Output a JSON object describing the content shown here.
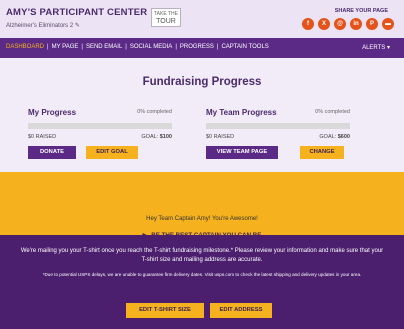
{
  "header": {
    "title": "AMY'S PARTICIPANT CENTER",
    "team": "Alzheimer's Eliminators 2",
    "edit_icon": "pencil-icon",
    "tour_small": "TAKE THE",
    "tour_big": "TOUR",
    "share_label": "SHARE YOUR PAGE",
    "social_icons": [
      "facebook-icon",
      "x-icon",
      "email-icon",
      "linkedin-icon",
      "pinterest-icon",
      "sms-icon"
    ],
    "social_glyphs": [
      "f",
      "X",
      "@",
      "in",
      "P",
      "▬"
    ]
  },
  "nav": {
    "items": [
      "DASHBOARD",
      "MY PAGE",
      "SEND EMAIL",
      "SOCIAL MEDIA",
      "PROGRESS",
      "CAPTAIN TOOLS"
    ],
    "alerts": "ALERTS ▾"
  },
  "fundraising": {
    "title": "Fundraising Progress",
    "my": {
      "title": "My Progress",
      "pct": "0% completed",
      "progress_fraction": 0,
      "raised": "$0 RAISED",
      "goal_label": "GOAL:",
      "goal_value": "$100",
      "btn1": "DONATE",
      "btn2": "EDIT GOAL"
    },
    "team": {
      "title": "My Team Progress",
      "pct": "0% completed",
      "progress_fraction": 0,
      "raised": "$0 RAISED",
      "goal_label": "GOAL:",
      "goal_value": "$600",
      "btn1": "VIEW TEAM PAGE",
      "btn2": "CHANGE"
    }
  },
  "captain": {
    "message": "Hey Team Captain Amy! You're Awesome!",
    "link": "BE THE BEST CAPTAIN YOU CAN BE"
  },
  "tshirt": {
    "text": "We're mailing you your T-shirt once you reach the T-shirt fundraising milestone.* Please review your information and make sure that your T-shirt size and mailing address are accurate.",
    "note": "*Due to potential USPS delays, we are unable to guarantee firm delivery dates. Visit usps.com to check the latest shipping and delivery updates in your area.",
    "btn_size": "EDIT T-SHIRT SIZE",
    "btn_address": "EDIT ADDRESS"
  },
  "colors": {
    "purple": "#5b2a86",
    "gold": "#f6b21e",
    "dark_purple": "#4b1f6e"
  }
}
